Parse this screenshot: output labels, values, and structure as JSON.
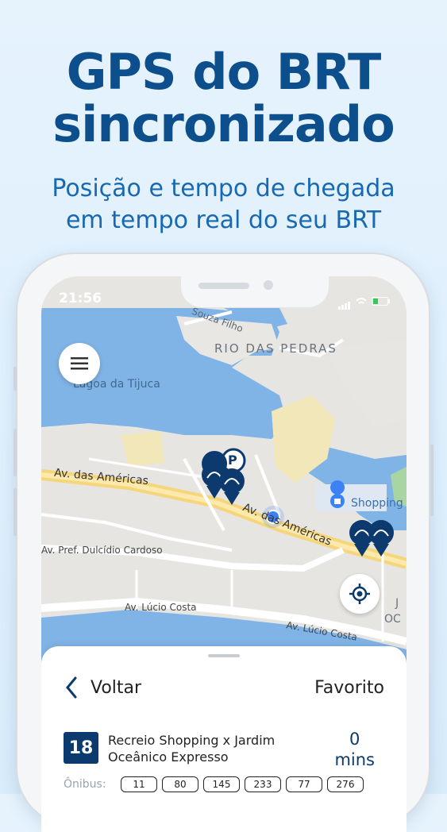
{
  "headline": {
    "line1": "GPS do BRT",
    "line2": "sincronizado"
  },
  "subheadline": {
    "line1": "Posição e tempo de chegada",
    "line2": "em tempo real do seu BRT"
  },
  "status_bar": {
    "time": "21:56"
  },
  "map": {
    "labels": {
      "souza_filho": "Souza Filho",
      "rio_das_pedras": "RIO DAS PEDRAS",
      "lagoa": "Lagoa da Tijuca",
      "av_americas_left": "Av. das Américas",
      "av_americas_right": "Av. das Américas",
      "dulcidio": "Av. Pref. Dulcídio Cardoso",
      "lucio_costa_1": "Av. Lúcio Costa",
      "lucio_costa_2": "Av. Lúcio Costa",
      "shopping": "Shopping",
      "edge_j": "J",
      "edge_oc": "OC"
    },
    "parking_glyph": "P"
  },
  "sheet": {
    "back_label": "Voltar",
    "favorite_label": "Favorito",
    "route_number": "18",
    "route_name_line1": "Recreio Shopping x Jardim",
    "route_name_line2": "Oceânico Expresso",
    "eta_value": "0",
    "eta_unit": "mins",
    "buses_label": "Ônibus:",
    "buses": [
      "11",
      "80",
      "145",
      "233",
      "77",
      "276"
    ]
  },
  "colors": {
    "headline": "#0d4f8c",
    "subheadline": "#1769b3",
    "water": "#7fb3e6",
    "route_badge": "#0d3a6e",
    "bus_pin": "#0d3a6e",
    "user_location": "#3b82f6"
  }
}
